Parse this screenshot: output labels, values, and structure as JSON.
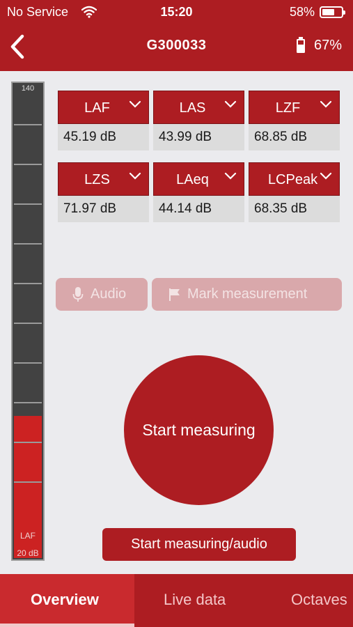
{
  "status_bar": {
    "carrier": "No Service",
    "time": "15:20",
    "phone_battery": "58%"
  },
  "nav": {
    "title": "G300033",
    "device_battery": "67%"
  },
  "meter": {
    "top_label": "140",
    "weighting": "LAF",
    "bottom_label": "20 dB",
    "level_fraction": 0.3
  },
  "cards": [
    {
      "label": "LAF",
      "value": "45.19 dB"
    },
    {
      "label": "LAS",
      "value": "43.99 dB"
    },
    {
      "label": "LZF",
      "value": "68.85 dB"
    },
    {
      "label": "LZS",
      "value": "71.97 dB"
    },
    {
      "label": "LAeq",
      "value": "44.14 dB"
    },
    {
      "label": "LCPeak",
      "value": "68.35 dB"
    }
  ],
  "actions": {
    "audio": "Audio",
    "mark": "Mark measurement"
  },
  "start_measuring": "Start measuring",
  "start_measuring_audio": "Start measuring/audio",
  "tabs": [
    {
      "label": "Overview",
      "active": true
    },
    {
      "label": "Live data",
      "active": false
    },
    {
      "label": "Octaves",
      "active": false
    }
  ],
  "colors": {
    "brand_red": "#ad1d22",
    "background": "#ebebee"
  }
}
